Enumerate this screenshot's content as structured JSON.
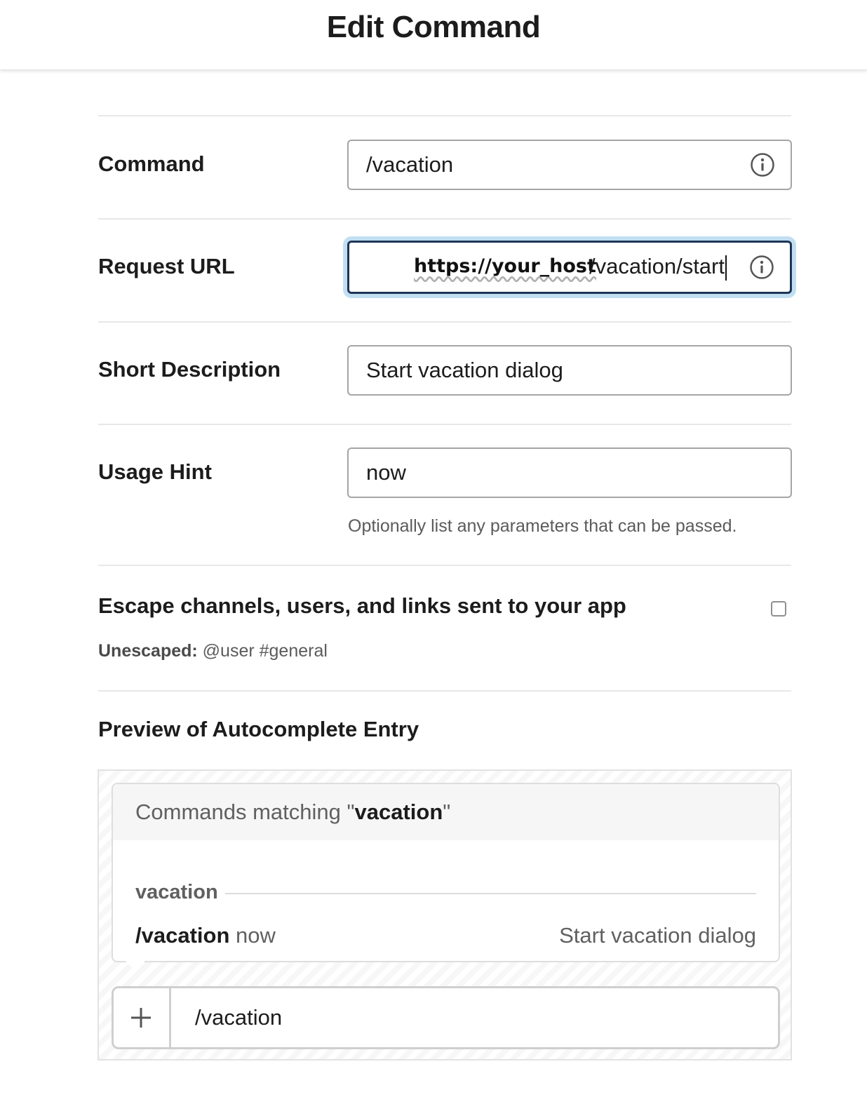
{
  "header": {
    "title": "Edit Command"
  },
  "form": {
    "command": {
      "label": "Command",
      "value": "/vacation"
    },
    "request_url": {
      "label": "Request URL",
      "host": "https://your_host",
      "path": "/vacation/start"
    },
    "short_description": {
      "label": "Short Description",
      "value": "Start vacation dialog"
    },
    "usage_hint": {
      "label": "Usage Hint",
      "value": "now",
      "help": "Optionally list any parameters that can be passed."
    },
    "escape": {
      "label": "Escape channels, users, and links sent to your app",
      "checked": false,
      "unescaped_label": "Unescaped:",
      "unescaped_example": "@user #general"
    }
  },
  "preview": {
    "title": "Preview of Autocomplete Entry",
    "matching_prefix": "Commands matching \"",
    "matching_term": "vacation",
    "matching_suffix": "\"",
    "group_name": "vacation",
    "entry": {
      "command": "/vacation",
      "hint": "now",
      "description": "Start vacation dialog"
    },
    "message_input": "/vacation"
  },
  "icons": {
    "info": "info-circle-icon",
    "plus": "plus-icon"
  },
  "colors": {
    "focus_ring": "#c2dff2",
    "focus_border": "#1d3557"
  }
}
